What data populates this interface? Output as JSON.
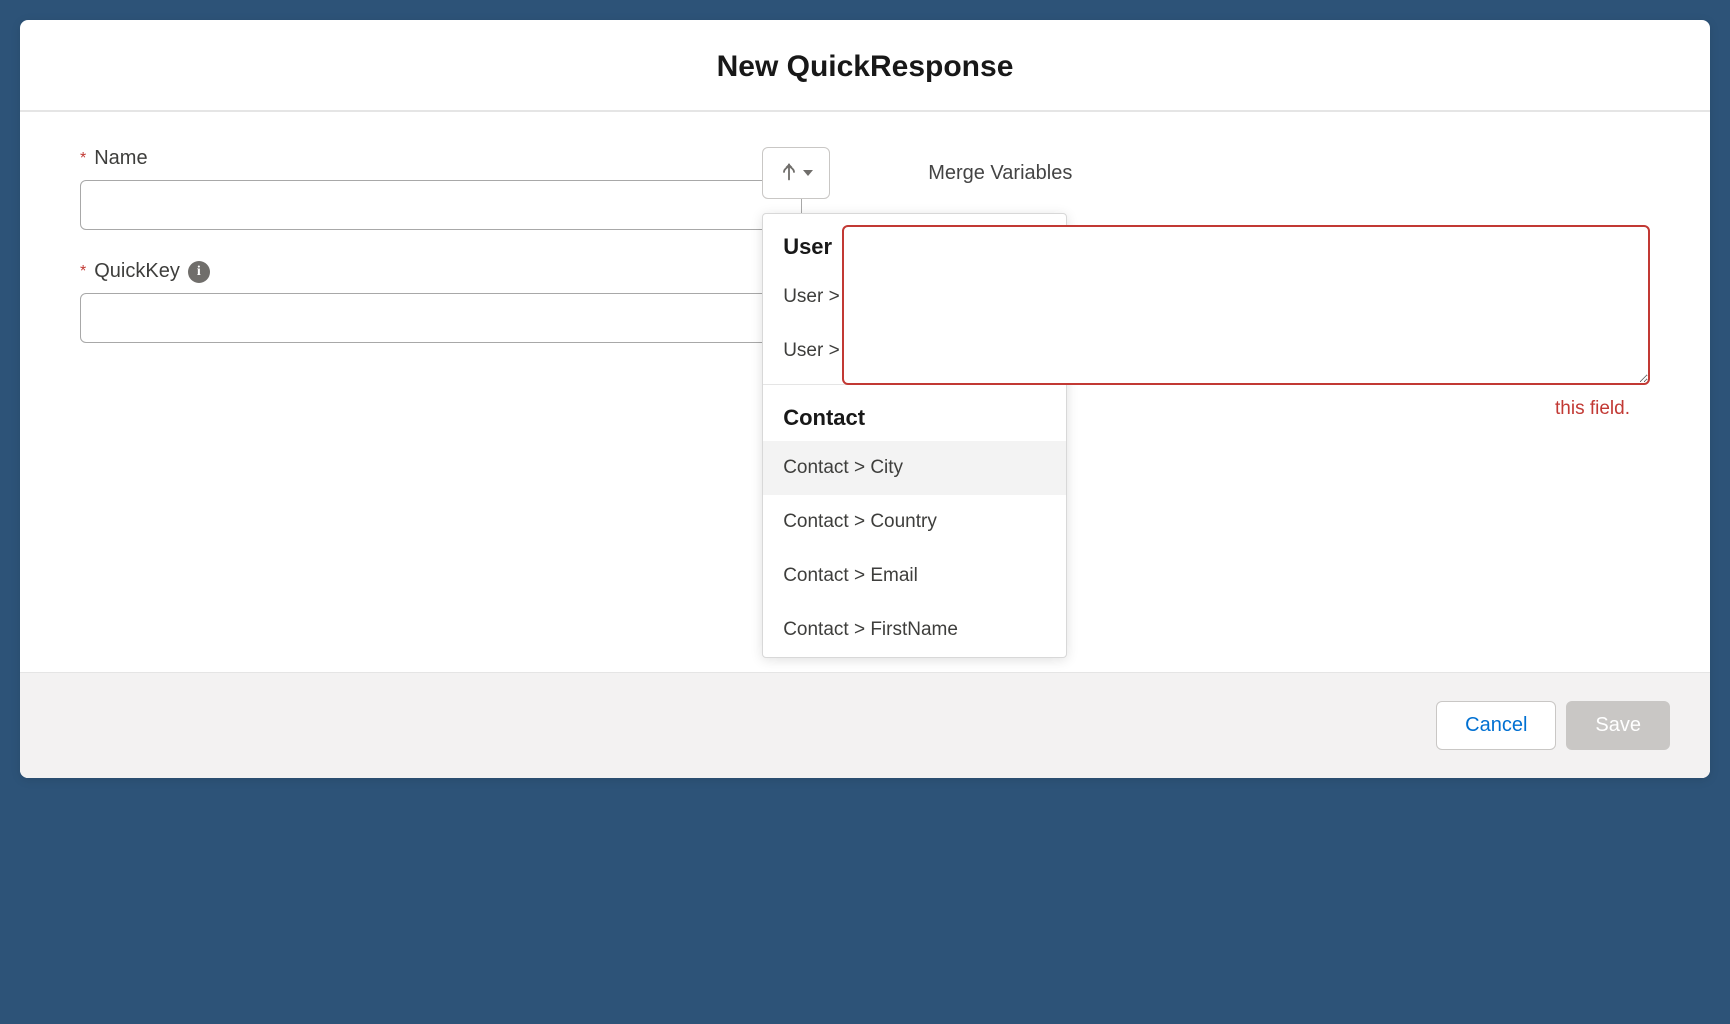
{
  "header": {
    "title": "New QuickResponse"
  },
  "form": {
    "name": {
      "label": "Name",
      "required_marker": "*",
      "value": ""
    },
    "quickkey": {
      "label": "QuickKey",
      "required_marker": "*",
      "value": ""
    },
    "merge": {
      "button_label": "Merge Variables"
    },
    "content": {
      "value": "",
      "error": "this field."
    }
  },
  "dropdown": {
    "groups": [
      {
        "title": "User",
        "items": [
          "User > FirstName",
          "User > FullName"
        ]
      },
      {
        "title": "Contact",
        "items": [
          "Contact > City",
          "Contact > Country",
          "Contact > Email",
          "Contact > FirstName"
        ]
      }
    ],
    "hover_item": "Contact > City"
  },
  "footer": {
    "cancel": "Cancel",
    "save": "Save"
  }
}
